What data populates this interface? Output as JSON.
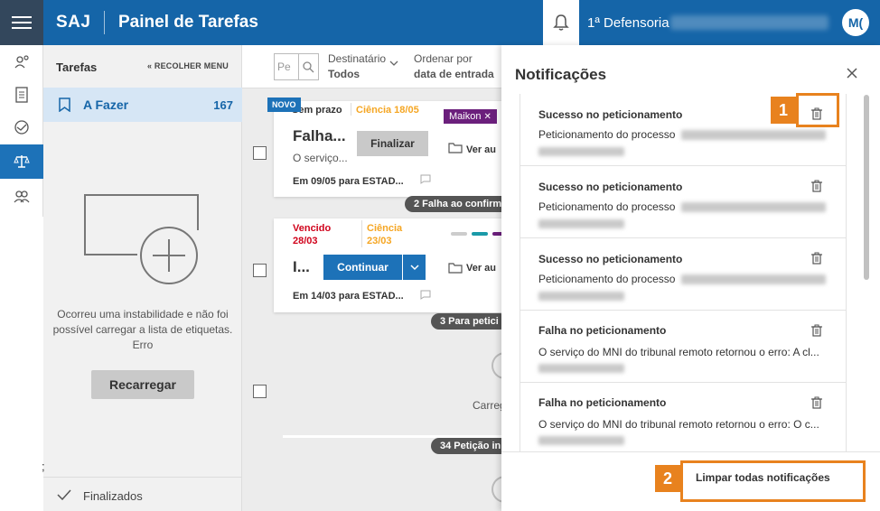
{
  "header": {
    "brand": "SAJ",
    "title": "Painel de Tarefas",
    "defensoria": "1ª Defensoria",
    "avatar_initials": "M("
  },
  "colors": {
    "primary": "#1565a8",
    "accent": "#e8821e",
    "tag_purple": "#6b1f7c",
    "red": "#d0021b",
    "orange": "#f5a623"
  },
  "sidebar": {
    "title": "Tarefas",
    "collapse_label": "RECOLHER MENU",
    "afazer_label": "A Fazer",
    "afazer_count": "167",
    "error_text": "Ocorreu uma instabilidade e não foi possível carregar a lista de etiquetas. Erro",
    "reload_label": "Recarregar",
    "semicolon": ";",
    "finalizados_label": "Finalizados"
  },
  "toolbar": {
    "search_placeholder": "Pe",
    "destinatario_label": "Destinatário",
    "destinatario_value": "Todos",
    "ordenar_label": "Ordenar por",
    "ordenar_value": "data de entrada"
  },
  "cards": [
    {
      "badge": "NOVO",
      "prazo": "Sem prazo",
      "ciencia": "Ciência 18/05",
      "tag": "Maikon",
      "title": "Falha...",
      "action": "Finalizar",
      "subtitle": "O serviço...",
      "date_text": "Em 09/05 para ESTAD...",
      "ver_label": "Ver au",
      "pill": "2 Falha ao confirm"
    },
    {
      "vencido": "Vencido",
      "vencido_date": "28/03",
      "ciencia": "Ciência",
      "ciencia_date": "23/03",
      "title": "I...",
      "action": "Continuar",
      "date_text": "Em 14/03 para ESTAD...",
      "ver_label": "Ver au",
      "pill": "3 Para petici"
    }
  ],
  "loading_text": "Carreg",
  "pill3": "34 Petição in",
  "notifications": {
    "title": "Notificações",
    "items": [
      {
        "title": "Sucesso no peticionamento",
        "message": "Peticionamento do processo"
      },
      {
        "title": "Sucesso no peticionamento",
        "message": "Peticionamento do processo"
      },
      {
        "title": "Sucesso no peticionamento",
        "message": "Peticionamento do processo"
      },
      {
        "title": "Falha no peticionamento",
        "message": "O serviço do MNI do tribunal remoto retornou o erro: A cl..."
      },
      {
        "title": "Falha no peticionamento",
        "message": "O serviço do MNI do tribunal remoto retornou o erro: O c..."
      }
    ],
    "clear_all_label": "Limpar todas notificações"
  },
  "callouts": {
    "one": "1",
    "two": "2"
  }
}
